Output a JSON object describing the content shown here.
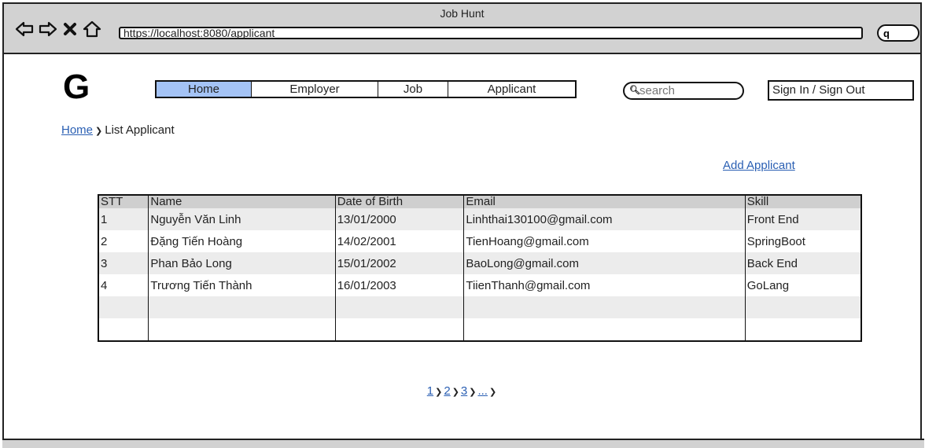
{
  "window": {
    "title": "Job Hunt"
  },
  "browser": {
    "url": "https://localhost:8080/applicant",
    "search_icon": "q"
  },
  "header": {
    "logo": "G",
    "nav": [
      {
        "label": "Home"
      },
      {
        "label": "Employer"
      },
      {
        "label": "Job"
      },
      {
        "label": "Applicant"
      }
    ],
    "search_placeholder": "search",
    "sign_label": "Sign In / Sign Out"
  },
  "breadcrumb": {
    "home": "Home",
    "current": "List Applicant"
  },
  "actions": {
    "add_applicant": "Add Applicant"
  },
  "table": {
    "headers": [
      "STT",
      "Name",
      "Date of Birth",
      "Email",
      "Skill"
    ],
    "rows": [
      [
        "1",
        "Nguyễn Văn Linh",
        "13/01/2000",
        "Linhthai130100@gmail.com",
        "Front End"
      ],
      [
        "2",
        "Đặng Tiến Hoàng",
        "14/02/2001",
        "TienHoang@gmail.com",
        "SpringBoot"
      ],
      [
        "3",
        "Phan Bảo Long",
        "15/01/2002",
        "BaoLong@gmail.com",
        "Back End"
      ],
      [
        "4",
        "Trương Tiến Thành",
        "16/01/2003",
        "TiienThanh@gmail.com",
        "GoLang"
      ],
      [
        "",
        "",
        "",
        "",
        ""
      ],
      [
        "",
        "",
        "",
        "",
        ""
      ]
    ]
  },
  "pagination": {
    "pages": [
      "1",
      "2",
      "3",
      "..."
    ]
  },
  "colors": {
    "active_tab": "#a4c3f5",
    "link": "#2a5fb3",
    "chrome": "#d2d2d2"
  }
}
